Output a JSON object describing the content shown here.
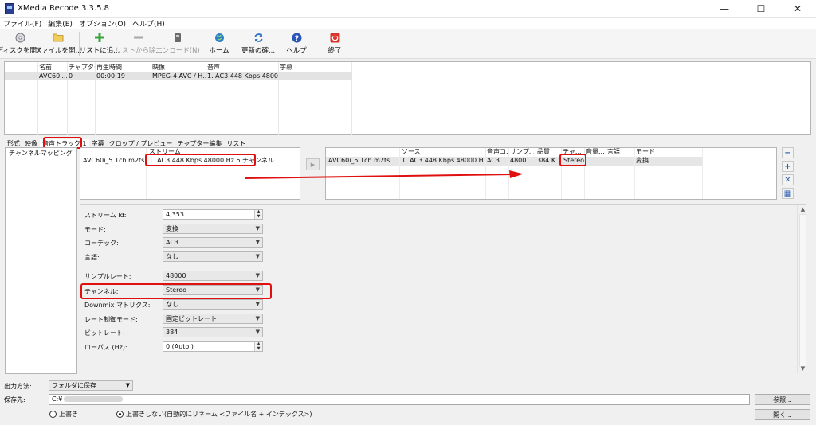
{
  "window": {
    "title": "XMedia Recode 3.3.5.8",
    "minimize": "—",
    "maximize": "☐",
    "close": "✕"
  },
  "menu": [
    "ファイル(F)",
    "編集(E)",
    "オプション(O)",
    "ヘルプ(H)"
  ],
  "toolbar": {
    "open_disc": "ディスクを開く",
    "open_file": "ファイルを開...",
    "add_list": "リストに追...",
    "remove_list": "リストから除...",
    "encode": "エンコード(N)",
    "home": "ホーム",
    "check_update": "更新の確...",
    "help": "ヘルプ",
    "exit": "終了"
  },
  "filelist": {
    "columns": [
      "名前",
      "チャプター",
      "再生時間",
      "映像",
      "音声",
      "字幕"
    ],
    "rows": [
      [
        "AVC60i...",
        "0",
        "00:00:19",
        "MPEG-4 AVC / H...",
        "1. AC3 448 Kbps 48000...",
        ""
      ]
    ]
  },
  "tabs": [
    "形式",
    "映像",
    "音声トラック 1",
    "字幕",
    "クロップ / プレビュー",
    "チャプター編集",
    "リスト"
  ],
  "left_pane": {
    "item": "チャンネルマッピング"
  },
  "source": {
    "header": "ストリーム",
    "file": "AVC60i_5.1ch.m2ts",
    "stream": "1. AC3 448 Kbps 48000 Hz 6 チャンネル"
  },
  "middle_button": "▶",
  "dest": {
    "columns": [
      "ソース",
      "音声コ...",
      "サンプ...",
      "品質",
      "チャ...",
      "音量...",
      "言語",
      "モード"
    ],
    "row": {
      "file": "AVC60i_5.1ch.m2ts",
      "source": "1. AC3 448 Kbps 48000 Hz ...",
      "codec": "AC3",
      "sample": "4800...",
      "quality": "384 K...",
      "channel": "Stereo",
      "volume": "",
      "language": "",
      "mode": "変換"
    }
  },
  "side_buttons": [
    "−",
    "+",
    "✕",
    "▦"
  ],
  "settings": {
    "stream_id": {
      "label": "ストリーム Id:",
      "value": "4,353"
    },
    "mode": {
      "label": "モード:",
      "value": "変換"
    },
    "codec": {
      "label": "コーデック:",
      "value": "AC3"
    },
    "language": {
      "label": "言語:",
      "value": "なし"
    },
    "sample_rate": {
      "label": "サンプルレート:",
      "value": "48000"
    },
    "channel": {
      "label": "チャンネル:",
      "value": "Stereo"
    },
    "downmix": {
      "label": "Downmix マトリクス:",
      "value": "なし"
    },
    "rate_control": {
      "label": "レート制御モード:",
      "value": "固定ビットレート"
    },
    "bitrate": {
      "label": "ビットレート:",
      "value": "384"
    },
    "lowpass": {
      "label": "ローパス (Hz):",
      "value": "0 (Auto.)"
    }
  },
  "scroll": {
    "up": "▲",
    "down": "▼"
  },
  "output": {
    "method_label": "出力方法:",
    "method_value": "フォルダに保存",
    "dest_label": "保存先:",
    "dest_value": "C:¥",
    "browse": "参照...",
    "open": "開く...",
    "overwrite": "上書き",
    "no_overwrite": "上書きしない(自動的にリネーム <ファイル名 + インデックス>)"
  },
  "colors": {
    "highlight": "#e01010",
    "accent": "#2a5db0"
  }
}
